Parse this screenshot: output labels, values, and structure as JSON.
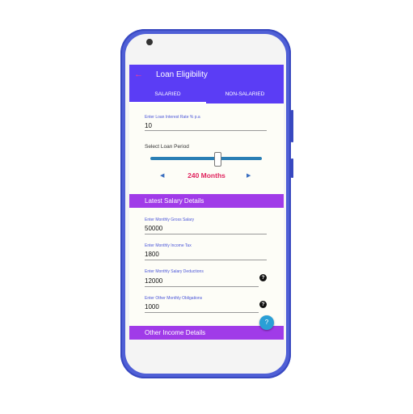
{
  "app": {
    "title": "Loan Eligibility",
    "back_icon": "arrow-left-icon"
  },
  "tabs": [
    {
      "label": "SALARIED",
      "active": true
    },
    {
      "label": "NON-SALARIED",
      "active": false
    }
  ],
  "interest": {
    "label": "Enter Loan Interest Rate % p.a",
    "value": "10"
  },
  "loan_period": {
    "label": "Select Loan Period",
    "value_text": "240 Months",
    "slider_fraction": 0.6
  },
  "salary_section": {
    "title": "Latest Salary Details",
    "fields": [
      {
        "label": "Enter Monthly Gross Salary",
        "value": "50000"
      },
      {
        "label": "Enter Monthly Income Tax",
        "value": "1800"
      },
      {
        "label": "Enter Monthly Salary Deductions",
        "value": "12000"
      },
      {
        "label": "Enter Other Monthly Obligations",
        "value": "1000"
      }
    ]
  },
  "other_section": {
    "title": "Other Income Details"
  },
  "colors": {
    "primary": "#5b3df5",
    "section": "#a03be8",
    "accent_text": "#e0245e",
    "phone_body": "#4f5fd6"
  }
}
